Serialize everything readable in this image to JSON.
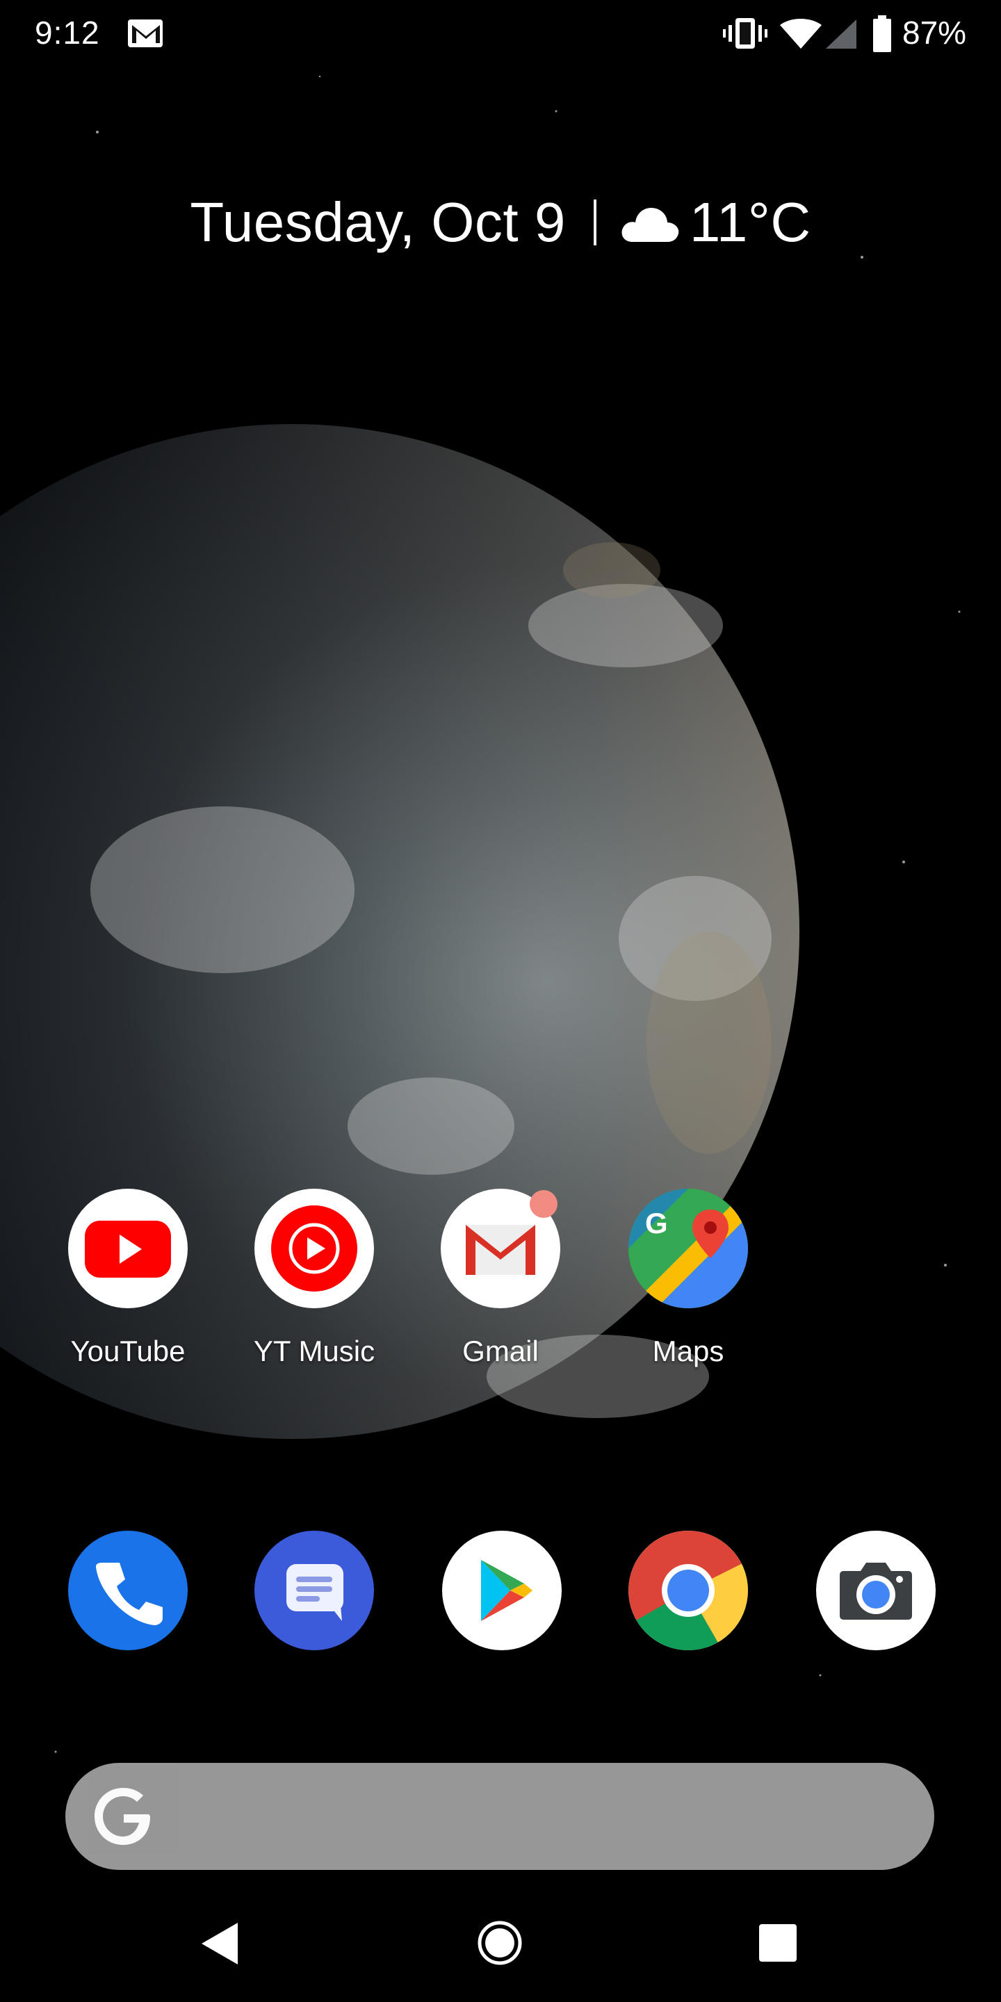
{
  "status_bar": {
    "time": "9:12",
    "battery_percent": "87%",
    "icons": [
      "gmail-notification-icon",
      "vibrate-icon",
      "wifi-icon",
      "cell-signal-icon",
      "battery-icon"
    ]
  },
  "glance": {
    "date": "Tuesday, Oct 9",
    "weather_icon": "cloud-icon",
    "temperature": "11°C"
  },
  "home_apps": [
    {
      "label": "YouTube",
      "icon": "youtube-icon"
    },
    {
      "label": "YT Music",
      "icon": "yt-music-icon"
    },
    {
      "label": "Gmail",
      "icon": "gmail-icon",
      "notification_dot": true
    },
    {
      "label": "Maps",
      "icon": "maps-icon"
    }
  ],
  "dock": [
    "phone-icon",
    "messages-icon",
    "play-store-icon",
    "chrome-icon",
    "camera-icon"
  ],
  "search": {
    "icon": "google-g-icon"
  },
  "nav": [
    "back-button",
    "home-button",
    "recents-button"
  ],
  "colors": {
    "youtube_red": "#FF0000",
    "phone_blue": "#1A73E8",
    "messages_blue": "#3B5BDB",
    "search_bar": "#9A9A9A",
    "gmail_dot": "#F28B82"
  }
}
